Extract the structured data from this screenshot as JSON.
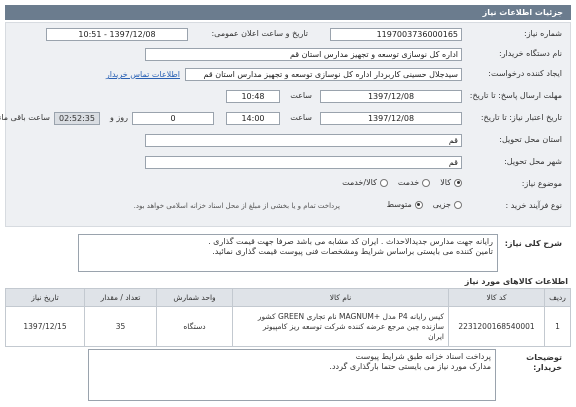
{
  "header": {
    "title": "جزئیات اطلاعات نیاز"
  },
  "form": {
    "need_number_label": "شماره نیاز:",
    "need_number": "1197003736000165",
    "announce_label": "تاریخ و ساعت اعلان عمومی:",
    "announce_value": "1397/12/08 - 10:51",
    "buyer_org_label": "نام دستگاه خریدار:",
    "buyer_org": "اداره کل نوسازی توسعه و تجهیز مدارس استان قم",
    "requester_label": "ایجاد کننده درخواست:",
    "requester": "سیدجلال حسینی کاربردار اداره کل نوسازی توسعه و تجهیز مدارس استان قم",
    "contact_link": "اطلاعات تماس خریدار",
    "send_deadline_label": "مهلت ارسال پاسخ: تا تاریخ:",
    "send_date": "1397/12/08",
    "send_time_label": "ساعت",
    "send_time": "10:48",
    "validity_label": "تاریخ اعتبار نیاز: تا تاریخ:",
    "valid_date": "1397/12/08",
    "valid_time_label": "ساعت",
    "valid_time": "14:00",
    "days_value": "0",
    "days_label": "روز و",
    "remaining_time": "02:52:35",
    "remaining_label": "ساعت باقی مانده",
    "delivery_province_label": "استان محل تحویل:",
    "delivery_province": "قم",
    "delivery_city_label": "شهر محل تحویل:",
    "delivery_city": "قم",
    "class_label": "موضوع نیاز:",
    "class_options": [
      "کالا",
      "خدمت",
      "کالا/خدمت"
    ],
    "class_selected": "کالا",
    "process_label": "نوع فرآیند خرید :",
    "process_options": [
      "جزیی",
      "متوسط"
    ],
    "process_selected": "متوسط",
    "process_note": "پرداخت تمام و یا بخشی از مبلغ از محل اسناد خزانه اسلامی خواهد بود."
  },
  "description": {
    "label": "شرح کلی نیاز:",
    "lines": [
      "رایانه جهت مدارس جدیدالاحداث . ایران کد مشابه می باشد صرفا جهت قیمت گذاری .",
      "تامین کننده می بایستی براساس شرایط ومشخصات فنی پیوست قیمت گذاری نمائید."
    ]
  },
  "items": {
    "section_title": "اطلاعات کالاهای مورد نیاز",
    "headers": [
      "ردیف",
      "کد کالا",
      "نام کالا",
      "واحد شمارش",
      "تعداد / مقدار",
      "تاریخ نیاز"
    ],
    "rows": [
      {
        "index": "1",
        "code": "2231200168540001",
        "name_lines": [
          "کیس رایانه P4 مدل +MAGNUM نام تجاری GREEN کشور",
          "سازنده چین مرجع عرضه کننده شرکت توسعه ریز کامپیوتر",
          "ایران"
        ],
        "unit": "دستگاه",
        "quantity": "35",
        "need_date": "1397/12/15"
      }
    ]
  },
  "buyer_notes": {
    "label_line1": "توضیحات",
    "label_line2": "خریدار:",
    "lines": [
      "پرداخت اسناد خزانه طبق شرایط پیوست",
      "مدارک مورد نیاز می بایستی حتما بارگذاری گردد."
    ]
  }
}
